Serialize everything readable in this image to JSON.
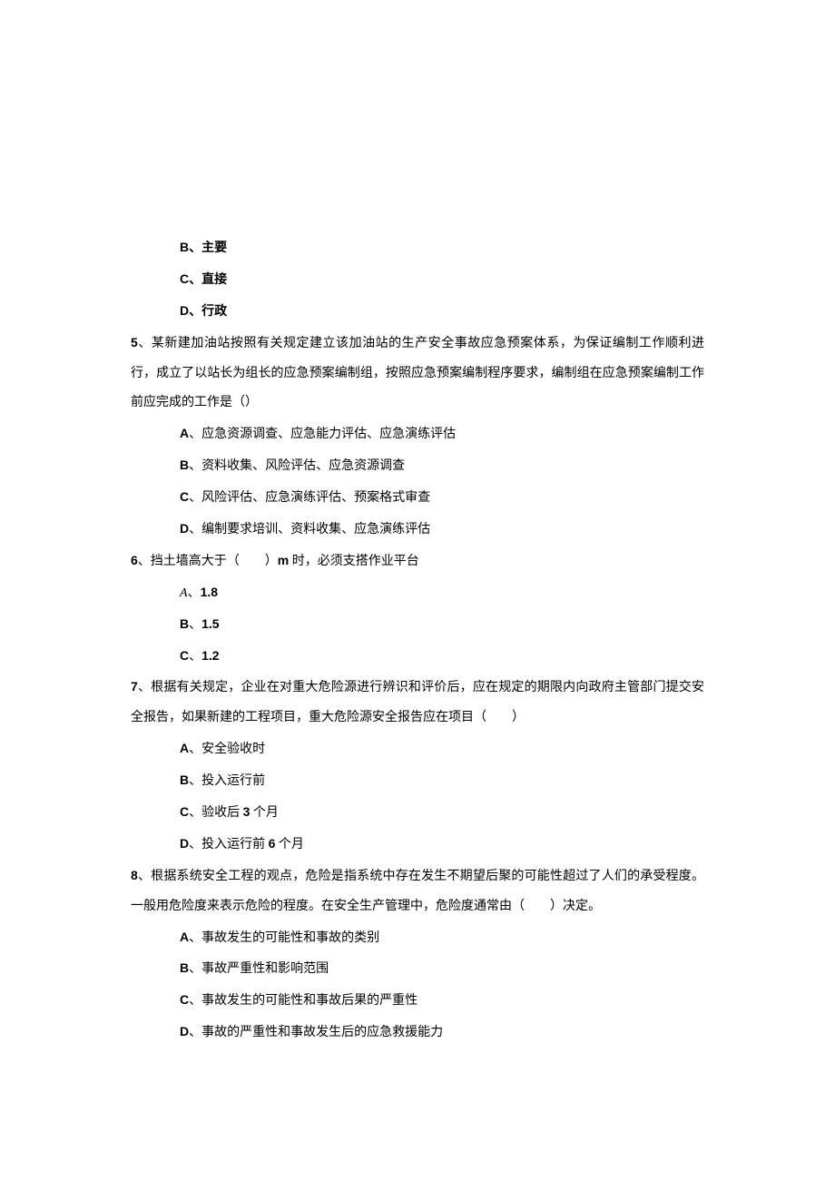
{
  "o4b": "B、主要",
  "o4c": "C、直接",
  "o4d": "D、行政",
  "q5_num": "5",
  "q5_text": "、某新建加油站按照有关规定建立该加油站的生产安全事故应急预案体系，为保证编制工作顺利进行，成立了以站长为组长的应急预案编制组，按照应急预案编制程序要求，编制组在应急预案编制工作前应完成的工作是（）",
  "o5a_l": "A",
  "o5a_t": "、应急资源调查、应急能力评估、应急演练评估",
  "o5b_l": "B",
  "o5b_t": "、资料收集、风险评估、应急资源调查",
  "o5c_l": "C",
  "o5c_t": "、风险评估、应急演练评估、预案格式审查",
  "o5d_l": "D",
  "o5d_t": "、编制要求培训、资料收集、应急演练评估",
  "q6_num": "6",
  "q6_t1": "、挡土墙高大于（　　）",
  "q6_m": "m",
  "q6_t2": " 时，必须支搭作业平台",
  "o6a_l": "A",
  "o6a_sep": "、",
  "o6a_v": "1.8",
  "o6b_l": "B",
  "o6b_sep": "、",
  "o6b_v": "1.5",
  "o6c_l": "C",
  "o6c_sep": "、",
  "o6c_v": "1.2",
  "q7_num": "7",
  "q7_text": "、根据有关规定，企业在对重大危险源进行辨识和评价后，应在规定的期限内向政府主管部门提交安全报告，如果新建的工程项目，重大危险源安全报告应在项目（　　）",
  "o7a_l": "A",
  "o7a_t": "、安全验收时",
  "o7b_l": "B",
  "o7b_t": "、投入运行前",
  "o7c_l": "C",
  "o7c_t1": "、验收后 ",
  "o7c_n": "3",
  "o7c_t2": " 个月",
  "o7d_l": "D",
  "o7d_t1": "、投入运行前 ",
  "o7d_n": "6",
  "o7d_t2": " 个月",
  "q8_num": "8",
  "q8_text": "、根据系统安全工程的观点，危险是指系统中存在发生不期望后聚的可能性超过了人们的承受程度。一般用危险度来表示危险的程度。在安全生产管理中，危险度通常由（　　）决定。",
  "o8a_l": "A",
  "o8a_t": "、事故发生的可能性和事故的类别",
  "o8b_l": "B",
  "o8b_t": "、事故严重性和影响范围",
  "o8c_l": "C",
  "o8c_t": "、事故发生的可能性和事故后果的严重性",
  "o8d_l": "D",
  "o8d_t": "、事故的严重性和事故发生后的应急救援能力"
}
